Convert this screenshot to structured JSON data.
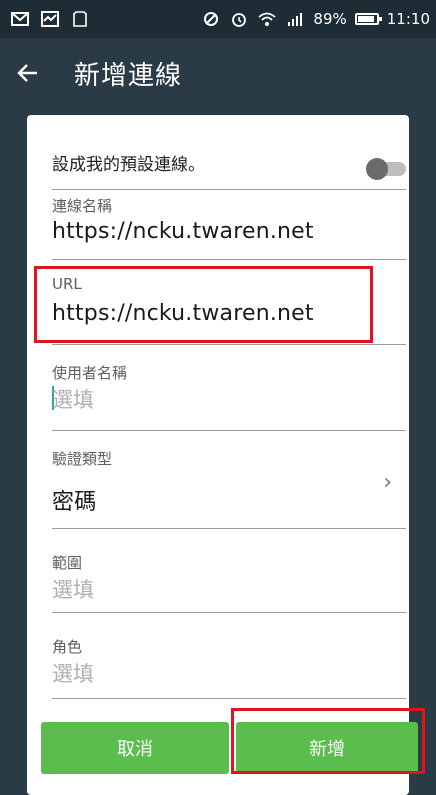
{
  "status_bar": {
    "battery_text": "89%",
    "time": "11:10",
    "battery_level": 0.89,
    "icons": [
      "gmail-icon",
      "activity-icon",
      "clipboard-icon",
      "sync-icon",
      "alarm-icon",
      "wifi-icon",
      "signal-icon",
      "battery-icon"
    ]
  },
  "app_bar": {
    "title": "新增連線"
  },
  "form": {
    "default_connection_label": "設成我的預設連線。",
    "default_connection_on": false,
    "name_label": "連線名稱",
    "name_value": "https://ncku.twaren.net",
    "url_label": "URL",
    "url_value": "https://ncku.twaren.net",
    "username_label": "使用者名稱",
    "username_placeholder": "選填",
    "auth_type_label": "驗證類型",
    "auth_type_value": "密碼",
    "scope_label": "範圍",
    "scope_placeholder": "選填",
    "role_label": "角色",
    "role_placeholder": "選填"
  },
  "buttons": {
    "cancel_label": "取消",
    "add_label": "新增"
  },
  "colors": {
    "app_bar": "#2a3b45",
    "button": "#5bbd4e",
    "highlight": "#e0141e",
    "cursor": "#2aa59b"
  }
}
